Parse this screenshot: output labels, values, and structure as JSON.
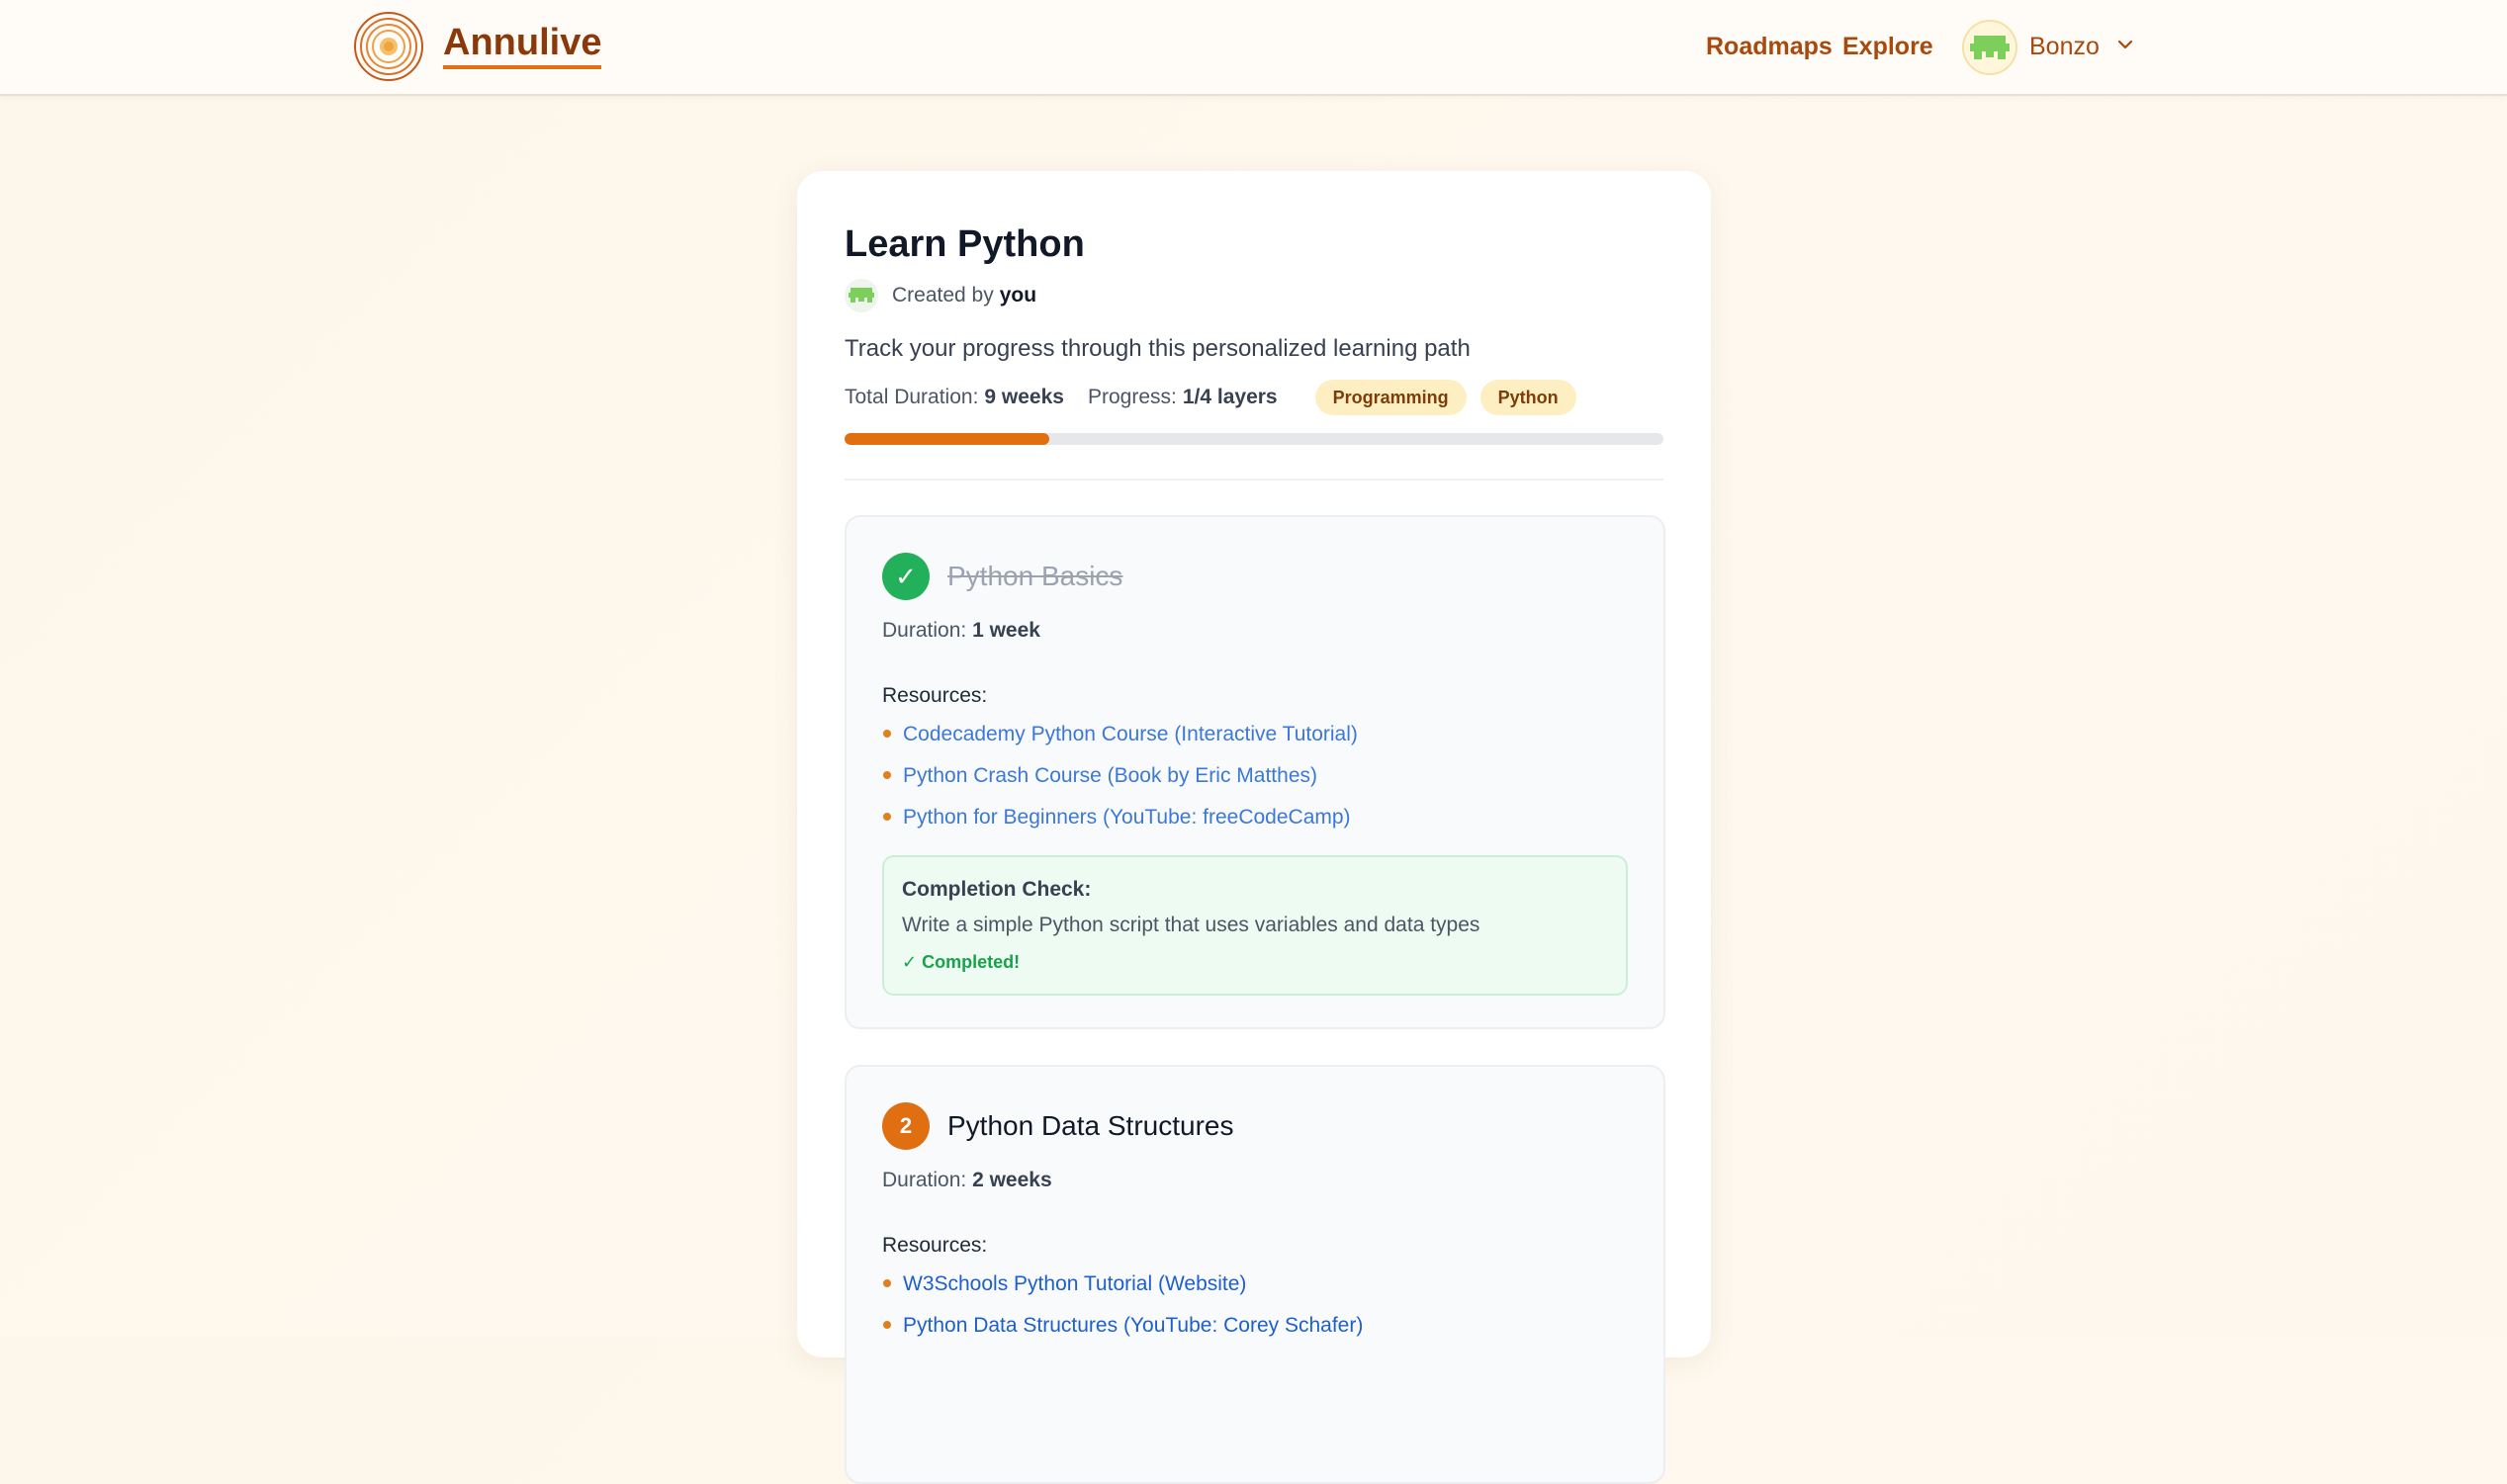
{
  "navbar": {
    "brand": "Annulive",
    "links": [
      "Roadmaps",
      "Explore"
    ],
    "user_name": "Bonzo"
  },
  "roadmap": {
    "title": "Learn Python",
    "created_by_label": "Created by",
    "created_by": "you",
    "description": "Track your progress through this personalized learning path",
    "total_duration_label": "Total Duration:",
    "total_duration": "9 weeks",
    "progress_label": "Progress:",
    "progress": "1/4 layers",
    "progress_fraction": 0.25,
    "tags": [
      "Programming",
      "Python"
    ]
  },
  "layers": [
    {
      "badge": "✓",
      "title": "Python Basics",
      "status": "completed",
      "duration_label": "Duration:",
      "duration": "1 week",
      "resources_label": "Resources:",
      "resources": [
        "Codecademy Python Course (Interactive Tutorial)",
        "Python Crash Course (Book by Eric Matthes)",
        "Python for Beginners (YouTube: freeCodeCamp)"
      ],
      "completion_check_label": "Completion Check:",
      "completion_check": "Write a simple Python script that uses variables and data types",
      "completion_status": "✓ Completed!"
    },
    {
      "badge": "2",
      "title": "Python Data Structures",
      "status": "active",
      "duration_label": "Duration:",
      "duration": "2 weeks",
      "resources_label": "Resources:",
      "resources": [
        "W3Schools Python Tutorial (Website)",
        "Python Data Structures (YouTube: Corey Schafer)"
      ]
    }
  ],
  "colors": {
    "accent": "#e06f12",
    "brand": "#8a3a0a",
    "success": "#22b05a",
    "link": "#3b78d8",
    "tag_bg": "#fdefc2"
  },
  "icons": {
    "logo": "concentric-rings-logo",
    "avatar": "pixel-avatar",
    "dropdown": "chevron-down-icon",
    "layer_done": "check-icon"
  }
}
